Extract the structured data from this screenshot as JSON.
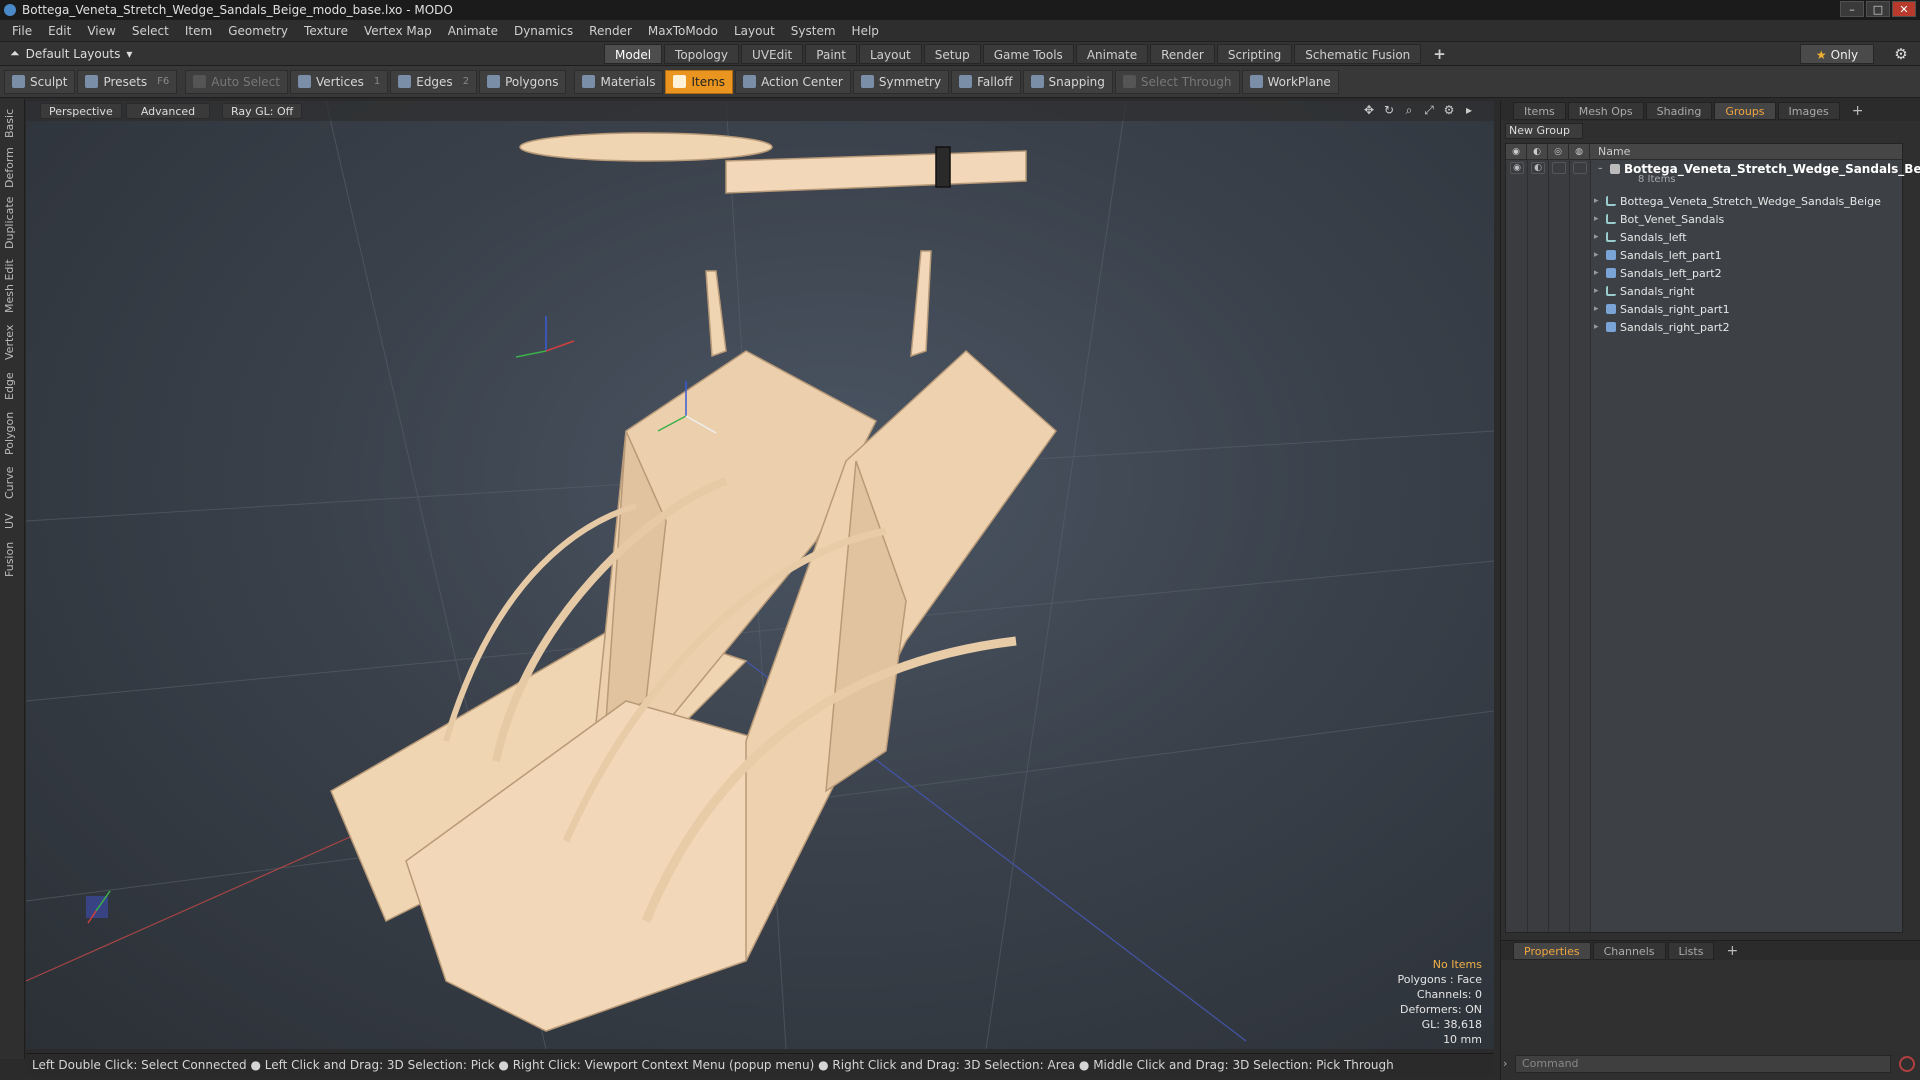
{
  "window": {
    "title": "Bottega_Veneta_Stretch_Wedge_Sandals_Beige_modo_base.lxo - MODO",
    "buttons": [
      "–",
      "□",
      "✕"
    ]
  },
  "menu": [
    "File",
    "Edit",
    "View",
    "Select",
    "Item",
    "Geometry",
    "Texture",
    "Vertex Map",
    "Animate",
    "Dynamics",
    "Render",
    "MaxToModo",
    "Layout",
    "System",
    "Help"
  ],
  "layout": {
    "selector": "Default Layouts",
    "tabs": [
      "Model",
      "Topology",
      "UVEdit",
      "Paint",
      "Layout",
      "Setup",
      "Game Tools",
      "Animate",
      "Render",
      "Scripting",
      "Schematic Fusion"
    ],
    "active_tab": "Model",
    "plus": "+",
    "only": "Only"
  },
  "toolbar": {
    "sculpt": "Sculpt",
    "presets": "Presets",
    "presets_key": "F6",
    "auto_select": "Auto Select",
    "vertices": "Vertices",
    "vertices_count": "1",
    "edges": "Edges",
    "edges_count": "2",
    "polygons": "Polygons",
    "materials": "Materials",
    "items": "Items",
    "action_center": "Action Center",
    "symmetry": "Symmetry",
    "falloff": "Falloff",
    "snapping": "Snapping",
    "select_through": "Select Through",
    "workplane": "WorkPlane"
  },
  "left_tabs": [
    "Basic",
    "Deform",
    "Duplicate",
    "Mesh Edit",
    "Vertex",
    "Edge",
    "Polygon",
    "Curve",
    "UV",
    "Fusion"
  ],
  "viewport": {
    "view": "Perspective",
    "shading": "Advanced",
    "raygl": "Ray GL: Off",
    "stats": {
      "selection": "No Items",
      "polygons": "Polygons : Face",
      "channels": "Channels: 0",
      "deformers": "Deformers: ON",
      "gl": "GL: 38,618",
      "scale": "10 mm"
    },
    "model_color": "#f2d8b8"
  },
  "status_bar": "Left Double Click: Select Connected ● Left Click and Drag: 3D Selection: Pick ● Right Click: Viewport Context Menu (popup menu) ● Right Click and Drag: 3D Selection: Area ● Middle Click and Drag: 3D Selection: Pick Through",
  "right_panel": {
    "tabs": [
      "Items",
      "Mesh Ops",
      "Shading",
      "Groups",
      "Images"
    ],
    "active_tab": "Groups",
    "new_group": "New Group",
    "column_name": "Name",
    "group": {
      "name": "Bottega_Veneta_Stretch_Wedge_Sandals_Be...",
      "count": "8 Items",
      "items": [
        {
          "name": "Bottega_Veneta_Stretch_Wedge_Sandals_Beige",
          "icon": "locator-icon"
        },
        {
          "name": "Bot_Venet_Sandals",
          "icon": "locator-icon"
        },
        {
          "name": "Sandals_left",
          "icon": "locator-icon"
        },
        {
          "name": "Sandals_left_part1",
          "icon": "mesh-icon"
        },
        {
          "name": "Sandals_left_part2",
          "icon": "mesh-icon"
        },
        {
          "name": "Sandals_right",
          "icon": "locator-icon"
        },
        {
          "name": "Sandals_right_part1",
          "icon": "mesh-icon"
        },
        {
          "name": "Sandals_right_part2",
          "icon": "mesh-icon"
        }
      ]
    },
    "bottom_tabs": [
      "Properties",
      "Channels",
      "Lists"
    ],
    "bottom_active": "Properties",
    "command_placeholder": "Command"
  },
  "colors": {
    "accent": "#e9951f",
    "active_tab_text": "#f0a640"
  }
}
